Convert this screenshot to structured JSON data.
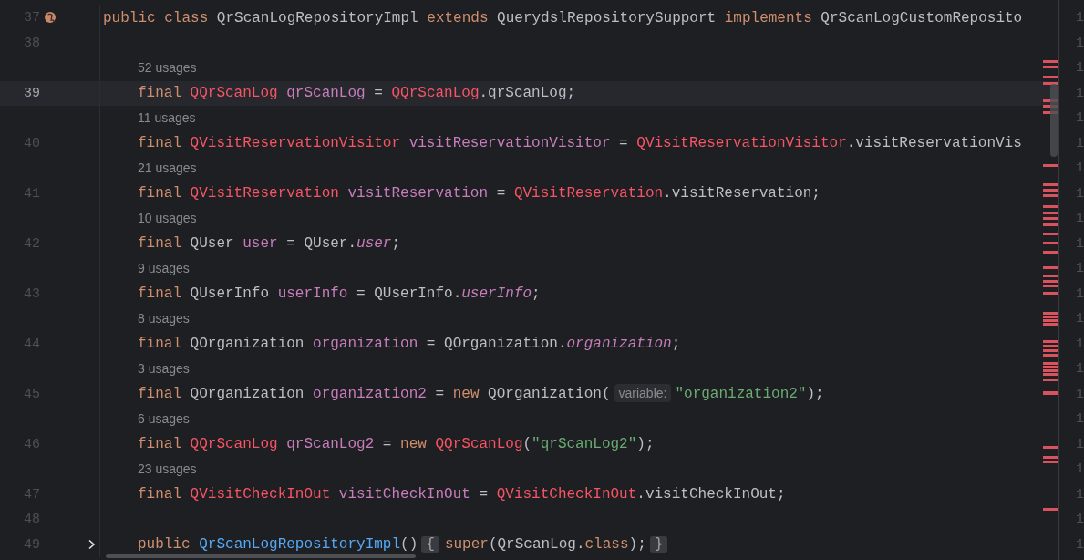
{
  "editor": {
    "rows": [
      {
        "kind": "code",
        "number": "37",
        "current": false,
        "gutter_icon": true,
        "tokens": [
          {
            "t": "public ",
            "kind": "keyword"
          },
          {
            "t": "class",
            "kind": "keyword"
          },
          {
            "t": " QrScanLogRepositoryImpl ",
            "kind": "plain"
          },
          {
            "t": "extends",
            "kind": "keyword"
          },
          {
            "t": " QuerydslRepositorySupport ",
            "kind": "plain"
          },
          {
            "t": "implements",
            "kind": "keyword"
          },
          {
            "t": " QrScanLogCustomReposito",
            "kind": "plain"
          }
        ]
      },
      {
        "kind": "code",
        "number": "38",
        "current": false,
        "tokens": []
      },
      {
        "kind": "usages",
        "text": "52 usages"
      },
      {
        "kind": "code",
        "number": "39",
        "current": true,
        "tokens": [
          {
            "t": "final ",
            "kind": "keyword"
          },
          {
            "t": "QQrScanLog ",
            "kind": "qtype"
          },
          {
            "t": "qrScanLog",
            "kind": "field"
          },
          {
            "t": " = ",
            "kind": "plain"
          },
          {
            "t": "QQrScanLog",
            "kind": "qtype"
          },
          {
            "t": ".qrScanLog;",
            "kind": "plain"
          }
        ]
      },
      {
        "kind": "usages",
        "text": "11 usages"
      },
      {
        "kind": "code",
        "number": "40",
        "current": false,
        "tokens": [
          {
            "t": "final ",
            "kind": "keyword"
          },
          {
            "t": "QVisitReservationVisitor ",
            "kind": "qtype"
          },
          {
            "t": "visitReservationVisitor",
            "kind": "field"
          },
          {
            "t": " = ",
            "kind": "plain"
          },
          {
            "t": "QVisitReservationVisitor",
            "kind": "qtype"
          },
          {
            "t": ".visitReservationVis",
            "kind": "plain"
          }
        ]
      },
      {
        "kind": "usages",
        "text": "21 usages"
      },
      {
        "kind": "code",
        "number": "41",
        "current": false,
        "tokens": [
          {
            "t": "final ",
            "kind": "keyword"
          },
          {
            "t": "QVisitReservation ",
            "kind": "qtype"
          },
          {
            "t": "visitReservation",
            "kind": "field"
          },
          {
            "t": " = ",
            "kind": "plain"
          },
          {
            "t": "QVisitReservation",
            "kind": "qtype"
          },
          {
            "t": ".visitReservation;",
            "kind": "plain"
          }
        ]
      },
      {
        "kind": "usages",
        "text": "10 usages"
      },
      {
        "kind": "code",
        "number": "42",
        "current": false,
        "tokens": [
          {
            "t": "final ",
            "kind": "keyword"
          },
          {
            "t": "QUser ",
            "kind": "plain"
          },
          {
            "t": "user",
            "kind": "field"
          },
          {
            "t": " = QUser.",
            "kind": "plain"
          },
          {
            "t": "user",
            "kind": "static"
          },
          {
            "t": ";",
            "kind": "plain"
          }
        ]
      },
      {
        "kind": "usages",
        "text": "9 usages"
      },
      {
        "kind": "code",
        "number": "43",
        "current": false,
        "tokens": [
          {
            "t": "final ",
            "kind": "keyword"
          },
          {
            "t": "QUserInfo ",
            "kind": "plain"
          },
          {
            "t": "userInfo",
            "kind": "field"
          },
          {
            "t": " = QUserInfo.",
            "kind": "plain"
          },
          {
            "t": "userInfo",
            "kind": "static"
          },
          {
            "t": ";",
            "kind": "plain"
          }
        ]
      },
      {
        "kind": "usages",
        "text": "8 usages"
      },
      {
        "kind": "code",
        "number": "44",
        "current": false,
        "tokens": [
          {
            "t": "final ",
            "kind": "keyword"
          },
          {
            "t": "QOrganization ",
            "kind": "plain"
          },
          {
            "t": "organization",
            "kind": "field"
          },
          {
            "t": " = QOrganization.",
            "kind": "plain"
          },
          {
            "t": "organization",
            "kind": "static"
          },
          {
            "t": ";",
            "kind": "plain"
          }
        ]
      },
      {
        "kind": "usages",
        "text": "3 usages"
      },
      {
        "kind": "code",
        "number": "45",
        "current": false,
        "tokens": [
          {
            "t": "final ",
            "kind": "keyword"
          },
          {
            "t": "QOrganization ",
            "kind": "plain"
          },
          {
            "t": "organization2",
            "kind": "field"
          },
          {
            "t": " = ",
            "kind": "plain"
          },
          {
            "t": "new",
            "kind": "keyword"
          },
          {
            "t": " QOrganization(",
            "kind": "plain"
          },
          {
            "t": "variable:",
            "kind": "hint"
          },
          {
            "t": "\"organization2\"",
            "kind": "string"
          },
          {
            "t": ");",
            "kind": "plain"
          }
        ]
      },
      {
        "kind": "usages",
        "text": "6 usages"
      },
      {
        "kind": "code",
        "number": "46",
        "current": false,
        "tokens": [
          {
            "t": "final ",
            "kind": "keyword"
          },
          {
            "t": "QQrScanLog ",
            "kind": "qtype"
          },
          {
            "t": "qrScanLog2",
            "kind": "field"
          },
          {
            "t": " = ",
            "kind": "plain"
          },
          {
            "t": "new ",
            "kind": "keyword"
          },
          {
            "t": "QQrScanLog",
            "kind": "qtype"
          },
          {
            "t": "(",
            "kind": "plain"
          },
          {
            "t": "\"qrScanLog2\"",
            "kind": "string"
          },
          {
            "t": ");",
            "kind": "plain"
          }
        ]
      },
      {
        "kind": "usages",
        "text": "23 usages"
      },
      {
        "kind": "code",
        "number": "47",
        "current": false,
        "tokens": [
          {
            "t": "final ",
            "kind": "keyword"
          },
          {
            "t": "QVisitCheckInOut ",
            "kind": "qtype"
          },
          {
            "t": "visitCheckInOut",
            "kind": "field"
          },
          {
            "t": " = ",
            "kind": "plain"
          },
          {
            "t": "QVisitCheckInOut",
            "kind": "qtype"
          },
          {
            "t": ".visitCheckInOut;",
            "kind": "plain"
          }
        ]
      },
      {
        "kind": "code",
        "number": "48",
        "current": false,
        "tokens": []
      },
      {
        "kind": "code",
        "number": "49",
        "current": false,
        "fold": true,
        "tokens": [
          {
            "t": "public ",
            "kind": "keyword"
          },
          {
            "t": "QrScanLogRepositoryImpl",
            "kind": "method"
          },
          {
            "t": "()",
            "kind": "plain"
          },
          {
            "t": "{",
            "kind": "fold"
          },
          {
            "t": "super",
            "kind": "keyword"
          },
          {
            "t": "(QrScanLog.",
            "kind": "plain"
          },
          {
            "t": "class",
            "kind": "keyword"
          },
          {
            "t": ");",
            "kind": "plain"
          },
          {
            "t": "}",
            "kind": "fold"
          }
        ]
      }
    ]
  },
  "right_pane": {
    "line_numbers": [
      "1",
      "1",
      "1",
      "1",
      "1",
      "1",
      "1",
      "1",
      "1",
      "1",
      "1",
      "1",
      "1",
      "1",
      "1",
      "1",
      "1",
      "1",
      "1",
      "1",
      "1",
      "1"
    ]
  }
}
